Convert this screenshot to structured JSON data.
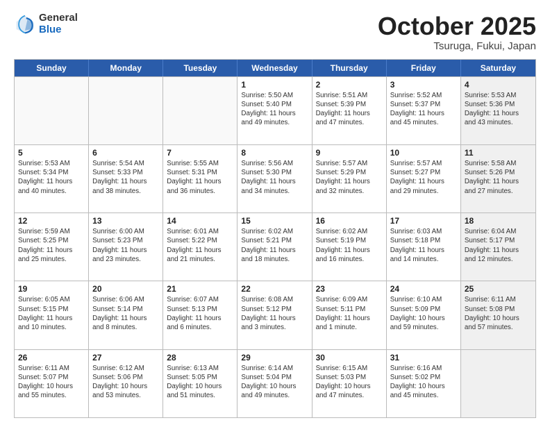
{
  "header": {
    "logo_general": "General",
    "logo_blue": "Blue",
    "month": "October 2025",
    "location": "Tsuruga, Fukui, Japan"
  },
  "weekdays": [
    "Sunday",
    "Monday",
    "Tuesday",
    "Wednesday",
    "Thursday",
    "Friday",
    "Saturday"
  ],
  "rows": [
    [
      {
        "day": "",
        "text": "",
        "empty": true
      },
      {
        "day": "",
        "text": "",
        "empty": true
      },
      {
        "day": "",
        "text": "",
        "empty": true
      },
      {
        "day": "1",
        "text": "Sunrise: 5:50 AM\nSunset: 5:40 PM\nDaylight: 11 hours\nand 49 minutes."
      },
      {
        "day": "2",
        "text": "Sunrise: 5:51 AM\nSunset: 5:39 PM\nDaylight: 11 hours\nand 47 minutes."
      },
      {
        "day": "3",
        "text": "Sunrise: 5:52 AM\nSunset: 5:37 PM\nDaylight: 11 hours\nand 45 minutes."
      },
      {
        "day": "4",
        "text": "Sunrise: 5:53 AM\nSunset: 5:36 PM\nDaylight: 11 hours\nand 43 minutes.",
        "shaded": true
      }
    ],
    [
      {
        "day": "5",
        "text": "Sunrise: 5:53 AM\nSunset: 5:34 PM\nDaylight: 11 hours\nand 40 minutes."
      },
      {
        "day": "6",
        "text": "Sunrise: 5:54 AM\nSunset: 5:33 PM\nDaylight: 11 hours\nand 38 minutes."
      },
      {
        "day": "7",
        "text": "Sunrise: 5:55 AM\nSunset: 5:31 PM\nDaylight: 11 hours\nand 36 minutes."
      },
      {
        "day": "8",
        "text": "Sunrise: 5:56 AM\nSunset: 5:30 PM\nDaylight: 11 hours\nand 34 minutes."
      },
      {
        "day": "9",
        "text": "Sunrise: 5:57 AM\nSunset: 5:29 PM\nDaylight: 11 hours\nand 32 minutes."
      },
      {
        "day": "10",
        "text": "Sunrise: 5:57 AM\nSunset: 5:27 PM\nDaylight: 11 hours\nand 29 minutes."
      },
      {
        "day": "11",
        "text": "Sunrise: 5:58 AM\nSunset: 5:26 PM\nDaylight: 11 hours\nand 27 minutes.",
        "shaded": true
      }
    ],
    [
      {
        "day": "12",
        "text": "Sunrise: 5:59 AM\nSunset: 5:25 PM\nDaylight: 11 hours\nand 25 minutes."
      },
      {
        "day": "13",
        "text": "Sunrise: 6:00 AM\nSunset: 5:23 PM\nDaylight: 11 hours\nand 23 minutes."
      },
      {
        "day": "14",
        "text": "Sunrise: 6:01 AM\nSunset: 5:22 PM\nDaylight: 11 hours\nand 21 minutes."
      },
      {
        "day": "15",
        "text": "Sunrise: 6:02 AM\nSunset: 5:21 PM\nDaylight: 11 hours\nand 18 minutes."
      },
      {
        "day": "16",
        "text": "Sunrise: 6:02 AM\nSunset: 5:19 PM\nDaylight: 11 hours\nand 16 minutes."
      },
      {
        "day": "17",
        "text": "Sunrise: 6:03 AM\nSunset: 5:18 PM\nDaylight: 11 hours\nand 14 minutes."
      },
      {
        "day": "18",
        "text": "Sunrise: 6:04 AM\nSunset: 5:17 PM\nDaylight: 11 hours\nand 12 minutes.",
        "shaded": true
      }
    ],
    [
      {
        "day": "19",
        "text": "Sunrise: 6:05 AM\nSunset: 5:15 PM\nDaylight: 11 hours\nand 10 minutes."
      },
      {
        "day": "20",
        "text": "Sunrise: 6:06 AM\nSunset: 5:14 PM\nDaylight: 11 hours\nand 8 minutes."
      },
      {
        "day": "21",
        "text": "Sunrise: 6:07 AM\nSunset: 5:13 PM\nDaylight: 11 hours\nand 6 minutes."
      },
      {
        "day": "22",
        "text": "Sunrise: 6:08 AM\nSunset: 5:12 PM\nDaylight: 11 hours\nand 3 minutes."
      },
      {
        "day": "23",
        "text": "Sunrise: 6:09 AM\nSunset: 5:11 PM\nDaylight: 11 hours\nand 1 minute."
      },
      {
        "day": "24",
        "text": "Sunrise: 6:10 AM\nSunset: 5:09 PM\nDaylight: 10 hours\nand 59 minutes."
      },
      {
        "day": "25",
        "text": "Sunrise: 6:11 AM\nSunset: 5:08 PM\nDaylight: 10 hours\nand 57 minutes.",
        "shaded": true
      }
    ],
    [
      {
        "day": "26",
        "text": "Sunrise: 6:11 AM\nSunset: 5:07 PM\nDaylight: 10 hours\nand 55 minutes."
      },
      {
        "day": "27",
        "text": "Sunrise: 6:12 AM\nSunset: 5:06 PM\nDaylight: 10 hours\nand 53 minutes."
      },
      {
        "day": "28",
        "text": "Sunrise: 6:13 AM\nSunset: 5:05 PM\nDaylight: 10 hours\nand 51 minutes."
      },
      {
        "day": "29",
        "text": "Sunrise: 6:14 AM\nSunset: 5:04 PM\nDaylight: 10 hours\nand 49 minutes."
      },
      {
        "day": "30",
        "text": "Sunrise: 6:15 AM\nSunset: 5:03 PM\nDaylight: 10 hours\nand 47 minutes."
      },
      {
        "day": "31",
        "text": "Sunrise: 6:16 AM\nSunset: 5:02 PM\nDaylight: 10 hours\nand 45 minutes."
      },
      {
        "day": "",
        "text": "",
        "empty": true,
        "shaded": true
      }
    ]
  ]
}
